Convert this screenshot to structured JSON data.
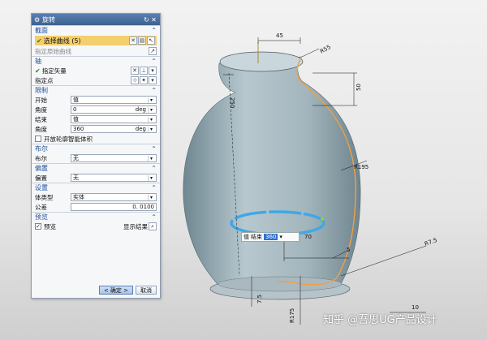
{
  "dialog": {
    "title": "旋转",
    "sections": {
      "section_curve": "截面",
      "axis": "轴",
      "limits": "限制",
      "boolean": "布尔",
      "offset": "偏置",
      "settings": "设置",
      "preview": "预览"
    },
    "select_curve_label": "选择曲线 (5)",
    "specify_origin_curve": "指定原始曲线",
    "specify_vector": "指定矢量",
    "specify_point": "指定点",
    "start_label": "开始",
    "start_mode": "值",
    "start_angle_label": "角度",
    "start_angle_value": "0",
    "end_label": "结束",
    "end_mode": "值",
    "end_angle_label": "角度",
    "end_angle_value": "360",
    "angle_unit": "deg",
    "open_profile_label": "开放轮廓智能体积",
    "boolean_label": "布尔",
    "boolean_value": "无",
    "offset_label": "偏置",
    "offset_value": "无",
    "body_type_label": "体类型",
    "body_type_value": "实体",
    "tolerance_label": "公差",
    "tolerance_value": "0. 0100",
    "preview_label": "预览",
    "show_result_label": "显示结果",
    "ok_button": "< 确定 >",
    "cancel_button": "取消"
  },
  "canvas_popup": {
    "mode": "值",
    "label": "结束",
    "value": "360"
  },
  "dimensions": {
    "d45": "45",
    "r55": "R55",
    "d50": "50",
    "d250": "250",
    "r195": "R195",
    "d70": "70",
    "d5": "5",
    "r75": "R7.5",
    "d10": "10",
    "r175": "R175",
    "d75": "7.5"
  },
  "watermark": "知乎 @吾思UG产品设计",
  "icons": {
    "gear": "gear-icon",
    "reset": "reset-icon",
    "close": "close-icon",
    "checkmark": "check-icon",
    "curve_select": "curve-select-icon",
    "vector": "vector-icon",
    "point": "point-icon",
    "preview_lens": "magnifier-icon"
  },
  "colors": {
    "dialog_title_bar": "#4a70a3",
    "section_header_text": "#1f4f9c",
    "selected_row": "#f4cf6d",
    "model_body": "#9fb0b8",
    "highlight_curve": "#f2a043",
    "rotation_handle": "#3fa8e6"
  }
}
